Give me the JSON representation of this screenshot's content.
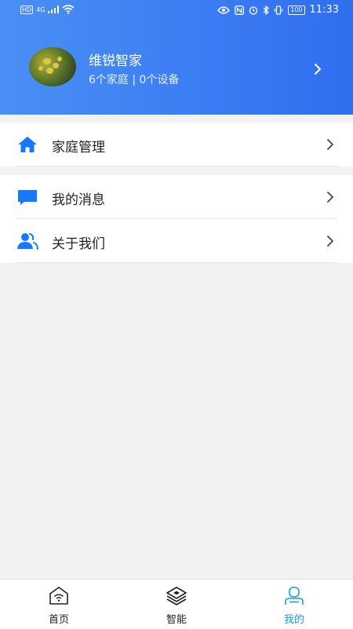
{
  "status_bar": {
    "hd": "HD",
    "network": "4G",
    "battery": "100",
    "time": "11:33"
  },
  "profile": {
    "name": "维锐智家",
    "home_count": "6个家庭",
    "separator": "|",
    "device_count": "0个设备"
  },
  "menu": {
    "family_management": "家庭管理",
    "my_messages": "我的消息",
    "about_us": "关于我们"
  },
  "tabbar": {
    "home": "首页",
    "smart": "智能",
    "mine": "我的"
  },
  "colors": {
    "header_gradient_start": "#4a8ff5",
    "header_gradient_end": "#2f6ef0",
    "icon_blue": "#1677ff",
    "active_tab": "#1a9fd0"
  },
  "icons": {
    "family": "house-icon",
    "messages": "chat-bubble-icon",
    "about": "people-icon",
    "home_tab": "wifi-house-icon",
    "smart_tab": "layers-icon",
    "mine_tab": "person-icon"
  }
}
